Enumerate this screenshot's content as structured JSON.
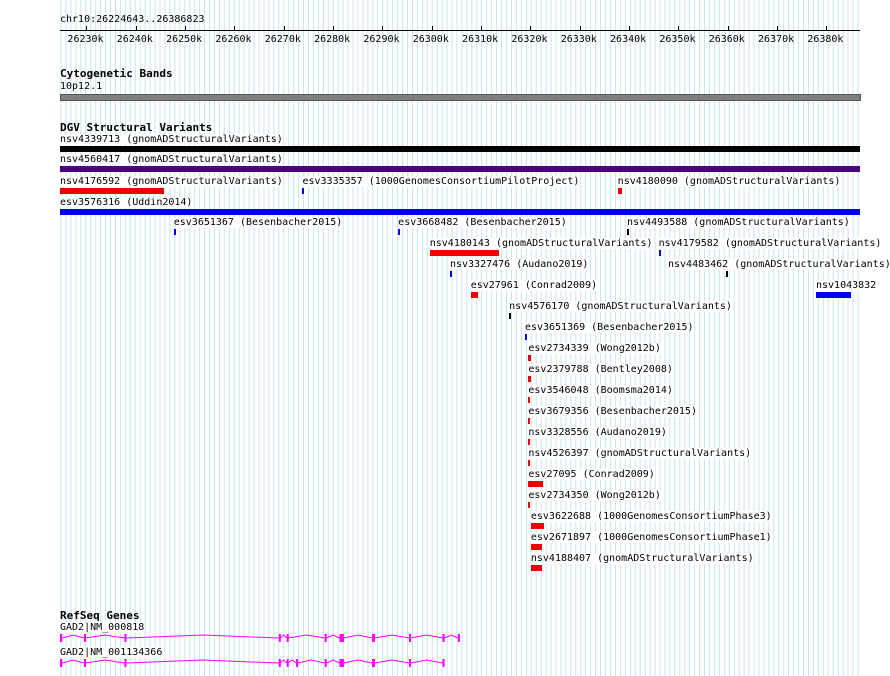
{
  "ruler": {
    "location": "chr10:26224643..26386823",
    "start": 26224643,
    "end": 26386823,
    "ticks": [
      "26230k",
      "26240k",
      "26250k",
      "26260k",
      "26270k",
      "26280k",
      "26290k",
      "26300k",
      "26310k",
      "26320k",
      "26330k",
      "26340k",
      "26350k",
      "26360k",
      "26370k",
      "26380k"
    ]
  },
  "cytobands": {
    "title": "Cytogenetic Bands",
    "band": "10p12.1"
  },
  "dgv": {
    "title": "DGV Structural Variants",
    "colors": {
      "black": "#000000",
      "purple": "#4b0082",
      "red": "#ee0000",
      "blue": "#0000ee"
    },
    "features": [
      {
        "label": "nsv4339713 (gnomADStructuralVariants)",
        "color": "black",
        "row": 0,
        "start": 26224643,
        "end": 26386823
      },
      {
        "label": "nsv4560417 (gnomADStructuralVariants)",
        "color": "purple",
        "row": 1,
        "start": 26224643,
        "end": 26386823
      },
      {
        "label": "nsv4176592 (gnomADStructuralVariants)",
        "color": "red",
        "row": 2,
        "start": 26224643,
        "end": 26245700
      },
      {
        "label": "esv3335357 (1000GenomesConsortiumPilotProject)",
        "color": "blue",
        "row": 2,
        "start": 26273800,
        "end": 26274200
      },
      {
        "label": "nsv4180090 (gnomADStructuralVariants)",
        "color": "red",
        "row": 2,
        "start": 26337700,
        "end": 26338600
      },
      {
        "label": "esv3576316 (Uddin2014)",
        "color": "blue",
        "row": 3,
        "start": 26224643,
        "end": 26386823
      },
      {
        "label": "esv3651367 (Besenbacher2015)",
        "color": "blue",
        "row": 4,
        "start": 26247700,
        "end": 26248100
      },
      {
        "label": "esv3668482 (Besenbacher2015)",
        "color": "blue",
        "row": 4,
        "start": 26293200,
        "end": 26293600
      },
      {
        "label": "nsv4493588 (gnomADStructuralVariants)",
        "color": "black",
        "row": 4,
        "start": 26339600,
        "end": 26339900
      },
      {
        "label": "nsv4180143 (gnomADStructuralVariants)",
        "color": "red",
        "row": 5,
        "start": 26299600,
        "end": 26313600
      },
      {
        "label": "nsv4179582 (gnomADStructuralVariants)",
        "color": "blue",
        "row": 5,
        "start": 26346000,
        "end": 26346400
      },
      {
        "label": "nsv3327476 (Audano2019)",
        "color": "blue",
        "row": 6,
        "start": 26303700,
        "end": 26304100
      },
      {
        "label": "nsv4483462 (gnomADStructuralVariants)",
        "color": "black",
        "row": 6,
        "start": 26359600,
        "end": 26359900
      },
      {
        "label": "nsv1043832",
        "color": "blue",
        "row": 7,
        "start": 26377900,
        "end": 26385000
      },
      {
        "label": "esv27961 (Conrad2009)",
        "color": "red",
        "row": 7,
        "start": 26307900,
        "end": 26309300
      },
      {
        "label": "nsv4576170 (gnomADStructuralVariants)",
        "color": "black",
        "row": 8,
        "start": 26315700,
        "end": 26316000
      },
      {
        "label": "esv3651369 (Besenbacher2015)",
        "color": "blue",
        "row": 9,
        "start": 26318900,
        "end": 26319300
      },
      {
        "label": "esv2734339 (Wong2012b)",
        "color": "red",
        "row": 10,
        "start": 26319600,
        "end": 26320100
      },
      {
        "label": "esv2379788 (Bentley2008)",
        "color": "red",
        "row": 11,
        "start": 26319600,
        "end": 26320100
      },
      {
        "label": "esv3546048 (Boomsma2014)",
        "color": "red",
        "row": 12,
        "start": 26319600,
        "end": 26319900
      },
      {
        "label": "esv3679356 (Besenbacher2015)",
        "color": "red",
        "row": 13,
        "start": 26319600,
        "end": 26319900
      },
      {
        "label": "nsv3328556 (Audano2019)",
        "color": "red",
        "row": 14,
        "start": 26319600,
        "end": 26319900
      },
      {
        "label": "nsv4526397 (gnomADStructuralVariants)",
        "color": "red",
        "row": 15,
        "start": 26319600,
        "end": 26319900
      },
      {
        "label": "esv27095 (Conrad2009)",
        "color": "red",
        "row": 16,
        "start": 26319600,
        "end": 26322500
      },
      {
        "label": "esv2734350 (Wong2012b)",
        "color": "red",
        "row": 17,
        "start": 26319600,
        "end": 26319900
      },
      {
        "label": "esv3622688 (1000GenomesConsortiumPhase3)",
        "color": "red",
        "row": 18,
        "start": 26320100,
        "end": 26322700
      },
      {
        "label": "esv2671897 (1000GenomesConsortiumPhase1)",
        "color": "red",
        "row": 19,
        "start": 26320100,
        "end": 26322300
      },
      {
        "label": "nsv4188407 (gnomADStructuralVariants)",
        "color": "red",
        "row": 20,
        "start": 26320100,
        "end": 26322300
      }
    ]
  },
  "refseq": {
    "title": "RefSeq Genes",
    "color": "#ff00ff",
    "genes": [
      {
        "label": "GAD2|NM_000818",
        "start": 26224643,
        "end": 26305700,
        "exons": [
          [
            26224643,
            26225100
          ],
          [
            26229500,
            26229800
          ],
          [
            26237700,
            26238000
          ],
          [
            26269000,
            26269300
          ],
          [
            26270600,
            26270900
          ],
          [
            26278300,
            26278700
          ],
          [
            26281300,
            26282200
          ],
          [
            26287900,
            26288500
          ],
          [
            26295400,
            26295700
          ],
          [
            26302200,
            26302600
          ],
          [
            26305300,
            26305700
          ]
        ]
      },
      {
        "label": "GAD2|NM_001134366",
        "start": 26224643,
        "end": 26302600,
        "exons": [
          [
            26224643,
            26225100
          ],
          [
            26229500,
            26229800
          ],
          [
            26237700,
            26238000
          ],
          [
            26269000,
            26269300
          ],
          [
            26270600,
            26270900
          ],
          [
            26272500,
            26272800
          ],
          [
            26278300,
            26278700
          ],
          [
            26281300,
            26282200
          ],
          [
            26287900,
            26288500
          ],
          [
            26295400,
            26295700
          ],
          [
            26302200,
            26302600
          ]
        ]
      }
    ]
  }
}
